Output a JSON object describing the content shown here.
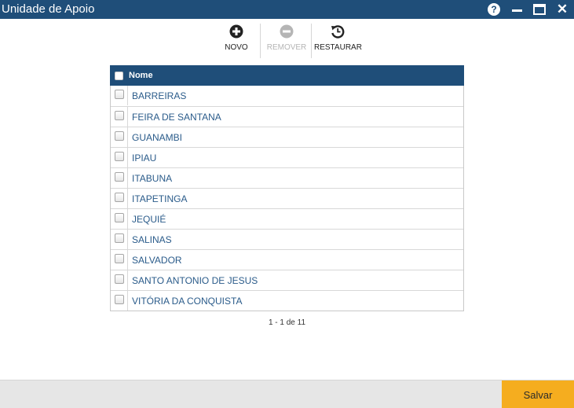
{
  "window": {
    "title": "Unidade de Apoio",
    "help_glyph": "?",
    "close_glyph": "✕"
  },
  "toolbar": {
    "novo_label": "NOVO",
    "remover_label": "REMOVER",
    "restaurar_label": "RESTAURAR"
  },
  "grid": {
    "header": "Nome",
    "rows": [
      "BARREIRAS",
      "FEIRA DE SANTANA",
      "GUANAMBI",
      "IPIAU",
      "ITABUNA",
      "ITAPETINGA",
      "JEQUIÉ",
      "SALINAS",
      "SALVADOR",
      "SANTO ANTONIO DE JESUS",
      "VITÓRIA DA CONQUISTA"
    ]
  },
  "pager": {
    "text": "1 - 1 de 11"
  },
  "footer": {
    "save_label": "Salvar"
  },
  "colors": {
    "accent": "#1f4e79",
    "save": "#f5ad1f",
    "link": "#2a5b8a"
  }
}
